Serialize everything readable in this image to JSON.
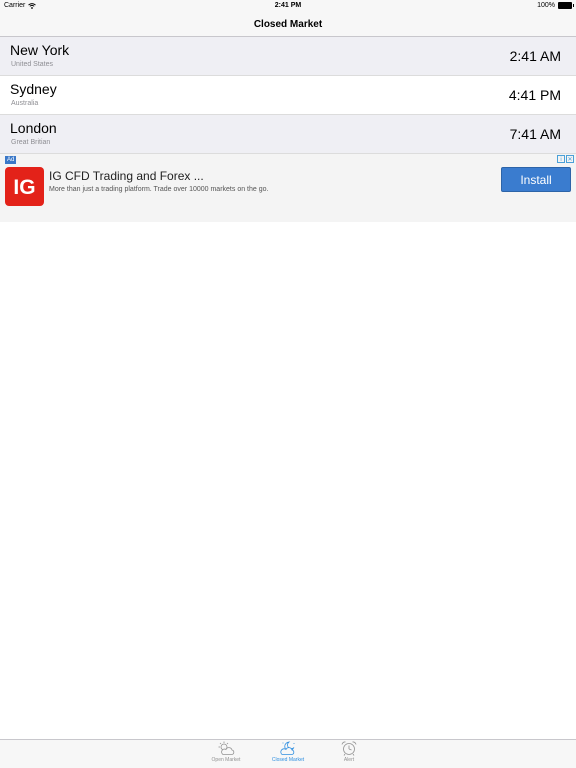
{
  "status_bar": {
    "carrier": "Carrier",
    "time": "2:41 PM",
    "battery": "100%"
  },
  "nav": {
    "title": "Closed Market"
  },
  "markets": [
    {
      "city": "New York",
      "country": "United States",
      "time": "2:41 AM"
    },
    {
      "city": "Sydney",
      "country": "Australia",
      "time": "4:41 PM"
    },
    {
      "city": "London",
      "country": "Great Britian",
      "time": "7:41 AM"
    }
  ],
  "ad": {
    "badge": "Ad",
    "logo_text": "IG",
    "title": "IG CFD Trading and Forex ...",
    "description": "More than just a trading platform. Trade over 10000 markets on the go.",
    "install_label": "Install",
    "brand_color": "#e32219",
    "button_color": "#3a7ccf"
  },
  "tabs": [
    {
      "label": "Open Market",
      "icon": "sun-cloud-icon",
      "active": false
    },
    {
      "label": "Closed Market",
      "icon": "moon-cloud-icon",
      "active": true
    },
    {
      "label": "Alert",
      "icon": "alarm-clock-icon",
      "active": false
    }
  ],
  "colors": {
    "active_tab": "#2f8fe0",
    "inactive_tab": "#929292",
    "shaded_row": "#efeff4"
  }
}
